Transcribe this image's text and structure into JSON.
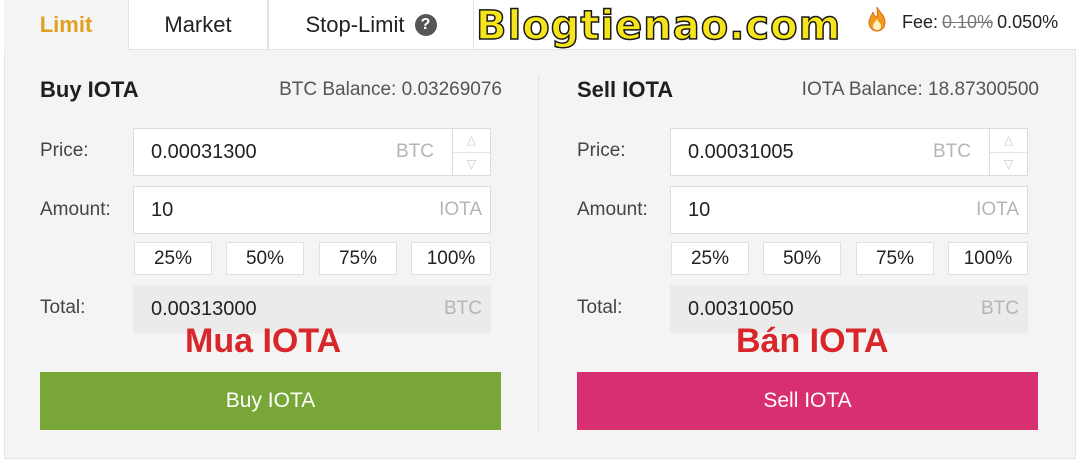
{
  "tabs": {
    "limit": "Limit",
    "market": "Market",
    "stop_limit": "Stop-Limit",
    "help_glyph": "?"
  },
  "watermark": "Blogtienao.com",
  "fee": {
    "label": "Fee:",
    "old_rate": "0.10%",
    "new_rate": "0.050%"
  },
  "buy": {
    "title": "Buy IOTA",
    "balance": "BTC Balance: 0.03269076",
    "price_label": "Price:",
    "price_value": "0.00031300",
    "price_unit": "BTC",
    "amount_label": "Amount:",
    "amount_value": "10",
    "amount_unit": "IOTA",
    "percentages": [
      "25%",
      "50%",
      "75%",
      "100%"
    ],
    "total_label": "Total:",
    "total_value": "0.00313000",
    "total_unit": "BTC",
    "overlay": "Mua IOTA",
    "button": "Buy IOTA"
  },
  "sell": {
    "title": "Sell IOTA",
    "balance": "IOTA Balance: 18.87300500",
    "price_label": "Price:",
    "price_value": "0.00031005",
    "price_unit": "BTC",
    "amount_label": "Amount:",
    "amount_value": "10",
    "amount_unit": "IOTA",
    "percentages": [
      "25%",
      "50%",
      "75%",
      "100%"
    ],
    "total_label": "Total:",
    "total_value": "0.00310050",
    "total_unit": "BTC",
    "overlay": "Bán IOTA",
    "button": "Sell IOTA"
  },
  "colors": {
    "active_tab": "#e0a020",
    "buy_button": "#78a737",
    "sell_button": "#d82f70",
    "overlay_text": "#d8262b"
  },
  "icons": {
    "help": "help-circle-icon",
    "flame": "flame-icon",
    "stepper_up": "chevron-up-icon",
    "stepper_down": "chevron-down-icon"
  }
}
